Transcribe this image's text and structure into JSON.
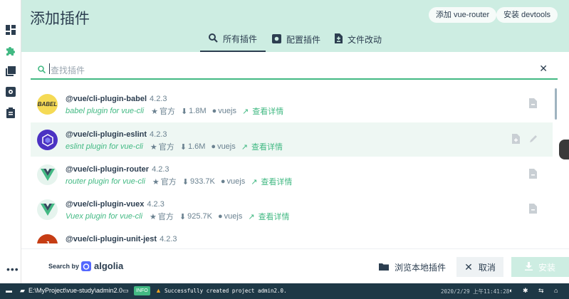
{
  "header": {
    "title": "添加插件",
    "buttons": [
      "添加 vue-router",
      "安装 devtools"
    ],
    "tabs": [
      {
        "label": "所有插件",
        "icon": "search-icon",
        "active": true
      },
      {
        "label": "配置插件",
        "icon": "gear-icon",
        "active": false
      },
      {
        "label": "文件改动",
        "icon": "file-diff-icon",
        "active": false
      }
    ]
  },
  "search": {
    "placeholder": "查找插件",
    "value": ""
  },
  "plugins": [
    {
      "name": "@vue/cli-plugin-babel",
      "version": "4.2.3",
      "description": "babel plugin for vue-cli",
      "official": "官方",
      "downloads": "1.8M",
      "author": "vuejs",
      "details": "查看详情",
      "logo": "babel-logo"
    },
    {
      "name": "@vue/cli-plugin-eslint",
      "version": "4.2.3",
      "description": "eslint plugin for vue-cli",
      "official": "官方",
      "downloads": "1.6M",
      "author": "vuejs",
      "details": "查看详情",
      "logo": "eslint-logo"
    },
    {
      "name": "@vue/cli-plugin-router",
      "version": "4.2.3",
      "description": "router plugin for vue-cli",
      "official": "官方",
      "downloads": "933.7K",
      "author": "vuejs",
      "details": "查看详情",
      "logo": "vue-logo"
    },
    {
      "name": "@vue/cli-plugin-vuex",
      "version": "4.2.3",
      "description": "Vuex plugin for vue-cli",
      "official": "官方",
      "downloads": "925.7K",
      "author": "vuejs",
      "details": "查看详情",
      "logo": "vue-logo"
    },
    {
      "name": "@vue/cli-plugin-unit-jest",
      "version": "4.2.3",
      "logo": "jest-logo"
    }
  ],
  "footer": {
    "search_by": "Search by",
    "algolia": "algolia",
    "browse_local": "浏览本地插件",
    "cancel": "取消",
    "install": "安装"
  },
  "statusbar": {
    "path": "E:\\MyProject\\vue-study\\admin2.0",
    "badge": "INFO",
    "message": "Successfully created project admin2.0.",
    "datetime": "2020/2/29 上午11:41:28"
  },
  "colors": {
    "accent": "#42b983",
    "header_bg": "#cdede2",
    "status_bg": "#1e3846",
    "text": "#2c3e50"
  }
}
